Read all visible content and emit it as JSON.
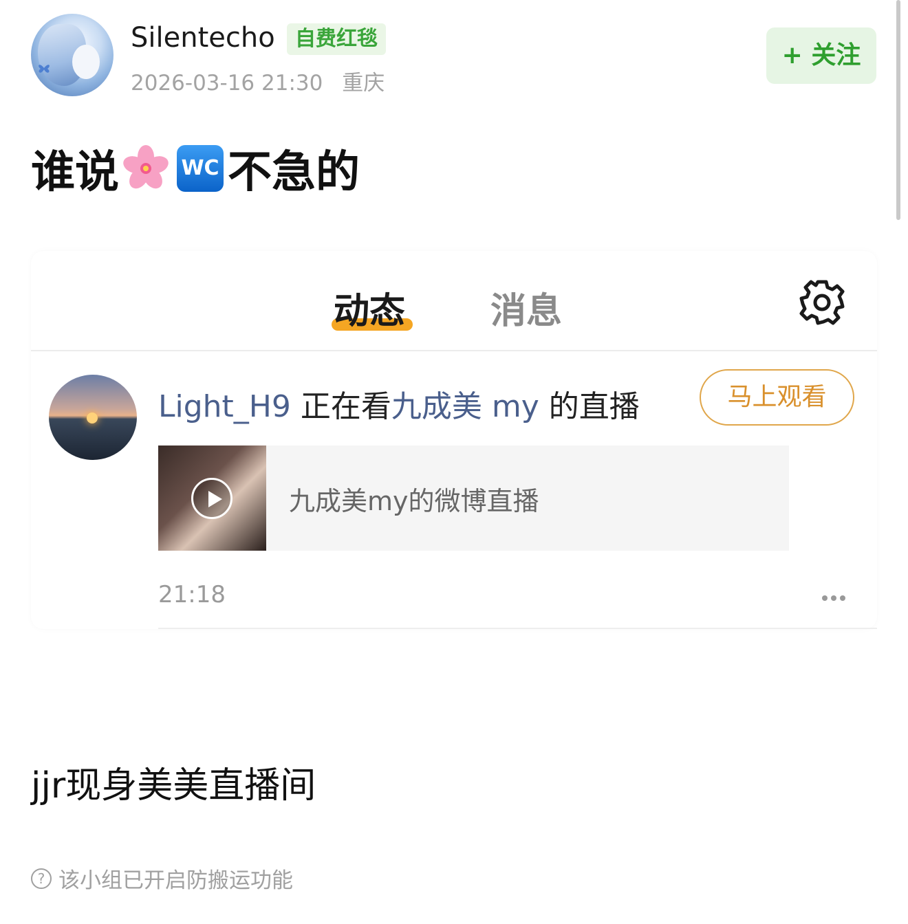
{
  "post": {
    "username": "Silentecho",
    "badge": "自费红毯",
    "timestamp": "2026-03-16 21:30",
    "location": "重庆",
    "follow_label": "+ 关注",
    "title_before": "谁说",
    "title_emoji_wc": "WC",
    "title_after": "不急的",
    "caption": "jjr现身美美直播间",
    "notice": "该小组已开启防搬运功能"
  },
  "screenshot": {
    "tabs": [
      {
        "label": "动态",
        "active": true
      },
      {
        "label": "消息",
        "active": false
      }
    ],
    "feed_item": {
      "user": "Light_H9",
      "action": "正在看",
      "streamer": "九成美 my",
      "suffix": "的直播",
      "watch_label": "马上观看",
      "live_title": "九成美my的微博直播",
      "time": "21:18"
    }
  },
  "colors": {
    "accent_green": "#2f9f2f",
    "tab_underline": "#f5a623",
    "watch_button": "#d9902c",
    "link_blue": "#4a5f8c"
  }
}
